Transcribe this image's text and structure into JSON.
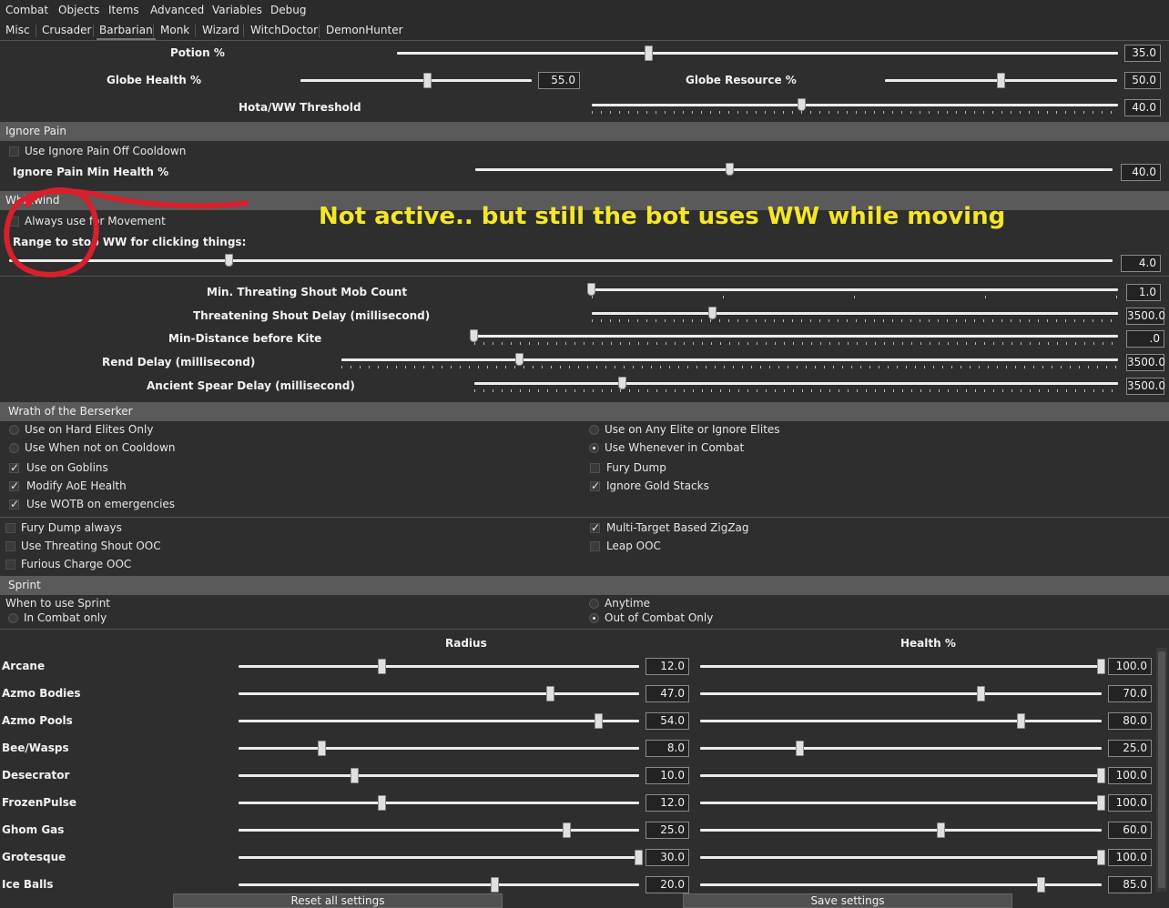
{
  "menu": [
    "Combat",
    "Objects",
    "Items",
    "Advanced",
    "Variables",
    "Debug"
  ],
  "tabs": [
    "Misc",
    "Crusader",
    "Barbarian",
    "Monk",
    "Wizard",
    "WitchDoctor",
    "DemonHunter"
  ],
  "active_tab": "Barbarian",
  "top": {
    "potion": {
      "label": "Potion %",
      "value": "35.0",
      "fraction": 0.35
    },
    "globe_health": {
      "label": "Globe Health %",
      "value": "55.0",
      "fraction": 0.55
    },
    "globe_resource": {
      "label": "Globe Resource %",
      "value": "50.0",
      "fraction": 0.5
    },
    "hota": {
      "label": "Hota/WW Threshold",
      "value": "40.0",
      "fraction": 0.4
    }
  },
  "ignore_pain": {
    "title": "Ignore Pain",
    "off_cooldown": "Use Ignore Pain Off Cooldown",
    "min_health": {
      "label": "Ignore Pain Min Health %",
      "value": "40.0",
      "fraction": 0.4
    }
  },
  "whirlwind": {
    "title": "Whirlwind",
    "always_use": "Always use for Movement",
    "range_label": "Range to stop WW for clicking things:",
    "range": {
      "value": "4.0",
      "fraction": 0.2
    }
  },
  "annotation": "Not active.. but still the bot uses WW while moving",
  "mid": {
    "threat_mob": {
      "label": "Min. Threating Shout Mob Count",
      "value": "1.0",
      "fraction": 0.0
    },
    "threat_delay": {
      "label": "Threatening Shout Delay (millisecond)",
      "value": "3500.0",
      "fraction": 0.23
    },
    "kite": {
      "label": "Min-Distance before Kite",
      "value": ".0",
      "fraction": 0.0
    },
    "rend": {
      "label": "Rend Delay (millisecond)",
      "value": "3500.0",
      "fraction": 0.23
    },
    "spear": {
      "label": "Ancient Spear Delay (millisecond)",
      "value": "3500.0",
      "fraction": 0.23
    }
  },
  "wotb": {
    "title": "Wrath of the Berserker",
    "hard_elites": "Use on Hard Elites Only",
    "any_elite": "Use on Any Elite or Ignore Elites",
    "not_cooldown": "Use When not on Cooldown",
    "whenever": "Use Whenever in Combat",
    "goblins": "Use on Goblins",
    "fury_dump": "Fury Dump",
    "aoe_health": "Modify AoE Health",
    "gold_stacks": "Ignore Gold Stacks",
    "emergencies": "Use WOTB on emergencies"
  },
  "misc": {
    "fury_always": "Fury Dump always",
    "zigzag": "Multi-Target Based ZigZag",
    "threat_ooc": "Use Threating Shout OOC",
    "leap_ooc": "Leap OOC",
    "charge_ooc": "Furious Charge OOC"
  },
  "sprint": {
    "title": "Sprint",
    "when": "When to use Sprint",
    "anytime": "Anytime",
    "in_combat": "In Combat only",
    "out_combat": "Out of Combat Only"
  },
  "aoe": {
    "radius_header": "Radius",
    "health_header": "Health %",
    "rows": [
      {
        "name": "Arcane",
        "radius": "12.0",
        "rf": 0.36,
        "health": "100.0",
        "hf": 1.0
      },
      {
        "name": "Azmo Bodies",
        "radius": "47.0",
        "rf": 0.78,
        "health": "70.0",
        "hf": 0.7
      },
      {
        "name": "Azmo Pools",
        "radius": "54.0",
        "rf": 0.9,
        "health": "80.0",
        "hf": 0.8
      },
      {
        "name": "Bee/Wasps",
        "radius": "8.0",
        "rf": 0.21,
        "health": "25.0",
        "hf": 0.25
      },
      {
        "name": "Desecrator",
        "radius": "10.0",
        "rf": 0.29,
        "health": "100.0",
        "hf": 1.0
      },
      {
        "name": "FrozenPulse",
        "radius": "12.0",
        "rf": 0.36,
        "health": "100.0",
        "hf": 1.0
      },
      {
        "name": "Ghom Gas",
        "radius": "25.0",
        "rf": 0.82,
        "health": "60.0",
        "hf": 0.6
      },
      {
        "name": "Grotesque",
        "radius": "30.0",
        "rf": 1.0,
        "health": "100.0",
        "hf": 1.0
      },
      {
        "name": "Ice Balls",
        "radius": "20.0",
        "rf": 0.64,
        "health": "85.0",
        "hf": 0.85
      }
    ]
  },
  "buttons": {
    "reset": "Reset all settings",
    "save": "Save settings"
  }
}
